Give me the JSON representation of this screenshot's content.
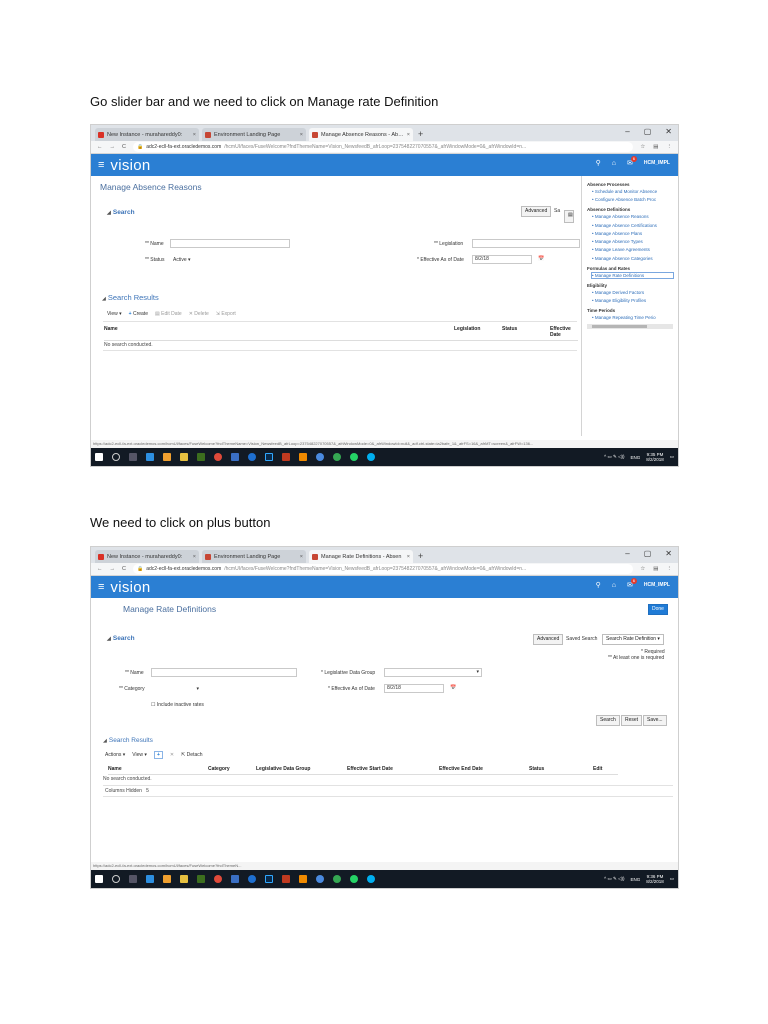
{
  "captions": {
    "first": "Go slider bar and we need to click on Manage rate Definition",
    "second": "We need to click on plus button"
  },
  "browser": {
    "tabs": [
      {
        "label": "New Instance - murahareddy0:",
        "close": "×"
      },
      {
        "label": "Environment Landing Page",
        "close": "×"
      },
      {
        "label_1": "Manage Absence Reasons - Abse",
        "label_2": "Manage Rate Definitions - Absen",
        "close": "×"
      }
    ],
    "new_tab": "+",
    "win_controls": [
      "–",
      "▢",
      "✕"
    ],
    "nav": [
      "←",
      "→",
      "C"
    ],
    "url_host": "adc2-ecll-fa-ext.oracledemos.com",
    "url_rest": "/hcmUI/faces/FuseWelcome?fndThemeName=Vision_NewsfeedB_afrLoop=237548227070557&_afrWindowMode=0&_afrWindowId=n...",
    "addr_icons": [
      "☆",
      "▤",
      "⋮"
    ]
  },
  "app": {
    "menu_icon": "≡",
    "logo": "vision",
    "user": "HCM_IMPL",
    "notification_count": "6"
  },
  "shot1": {
    "page_title": "Manage Absence Reasons",
    "search_title": "Search",
    "advanced": "Advanced",
    "advanced_cut": "Sa",
    "name_label": "** Name",
    "legislation_label": "** Legislation",
    "status_label": "** Status",
    "status_value": "Active",
    "effective_label": "* Effective As of Date",
    "effective_value": "8/2/18",
    "results_title": "Search Results",
    "toolbar": [
      "View ▾",
      "Create",
      "Edit Date",
      "Delete",
      "Export"
    ],
    "columns": [
      "Name",
      "Legislation",
      "Status",
      "Effective Date"
    ],
    "no_search": "No search conducted.",
    "status_url": "https://adc2-ecll-fa-ext.oracledemos.com/hcmUI/faces/FuseWelcome?fndThemeName=Vision_NewsfeedB_afrLoop=237548227070557&_afrWindowMode=0&_afrWindowId=null&_adf.ctrl-state=ia2bafe_1&_afrFS=16&_afrMT=screen&_afrFW=136...",
    "panel": [
      {
        "heading": "Absence Processes",
        "items": [
          "Schedule and Monitor Absence",
          "Configure Absence Batch Proc"
        ]
      },
      {
        "heading": "Absence Definitions",
        "items": [
          "Manage Absence Reasons",
          "Manage Absence Certifications",
          "Manage Absence Plans",
          "Manage Absence Types",
          "Manage Leave Agreements",
          "Manage Absence Categories"
        ]
      },
      {
        "heading": "Formulas and Rates",
        "items": [
          "Manage Rate Definitions"
        ]
      },
      {
        "heading": "Eligibility",
        "items": [
          "Manage Derived Factors",
          "Manage Eligibility Profiles"
        ]
      },
      {
        "heading": "Time Periods",
        "items": [
          "Manage Repeating Time Perio"
        ]
      }
    ],
    "clock_time": "9:35 PM",
    "clock_date": "8/2/2018"
  },
  "shot2": {
    "page_title": "Manage Rate Definitions",
    "done": "Done",
    "search_title": "Search",
    "advanced": "Advanced",
    "saved_search": "Saved Search",
    "saved_search_value": "Search Rate Definition ▾",
    "required": "* Required",
    "at_least_one": "** At least one is required",
    "name_label": "** Name",
    "ldg_label": "* Legislative Data Group",
    "category_label": "** Category",
    "effective_label": "* Effective As of Date",
    "effective_value": "8/2/18",
    "include_inactive": "Include inactive rates",
    "search_btn": "Search",
    "reset_btn": "Reset",
    "save_btn": "Save...",
    "results_title": "Search Results",
    "toolbar": [
      "Actions ▾",
      "View ▾",
      "+",
      "✕",
      "Detach"
    ],
    "columns": [
      "Name",
      "Category",
      "Legislative Data Group",
      "Effective Start Date",
      "Effective End Date",
      "Status",
      "Edit"
    ],
    "no_search": "No search conducted.",
    "columns_hidden": "Columns Hidden",
    "columns_hidden_count": "5",
    "status_url": "https://adc2-ecll-fa-ext.oracledemos.com/hcmUI/faces/FuseWelcome?fndThemeN...",
    "clock_time": "9:36 PM",
    "clock_date": "8/2/2018"
  },
  "taskbar": {
    "lang": "ENG",
    "tray": "^ ▭ ✎ ◁))"
  },
  "colors": {
    "header_blue": "#2b7fd3",
    "link_blue": "#2b6cb8",
    "taskbar": "#121a24"
  }
}
